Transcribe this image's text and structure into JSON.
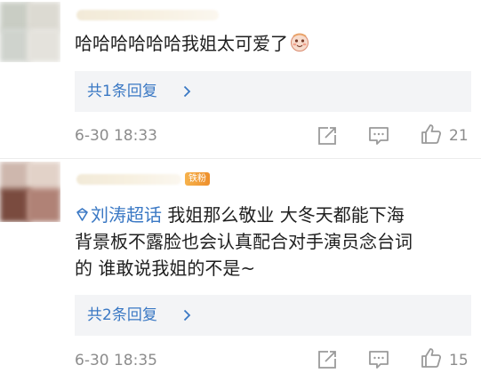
{
  "comments": [
    {
      "text": "哈哈哈哈哈哈我姐太可爱了",
      "emoji_icon": "sticker-icon",
      "reply_link": "共1条回复",
      "timestamp": "6-30 18:33",
      "like_count": "21",
      "action_icons": [
        "share-icon",
        "comment-icon",
        "like-icon"
      ]
    },
    {
      "badge": "铁粉",
      "topic": "刘涛超话",
      "topic_icon": "topic-icon",
      "text_lines": [
        "我姐那么敬业 大冬天都能下海",
        "背景板不露脸也会认真配合对手演员念台词",
        "的 谁敢说我姐的不是~"
      ],
      "reply_link": "共2条回复",
      "timestamp": "6-30 18:35",
      "like_count": "15",
      "action_icons": [
        "share-icon",
        "comment-icon",
        "like-icon"
      ]
    }
  ],
  "colors": {
    "link": "#3a78c4",
    "meta": "#8c8c8c",
    "reply_bg": "#f3f4f6",
    "badge": "#ee8f2c"
  }
}
